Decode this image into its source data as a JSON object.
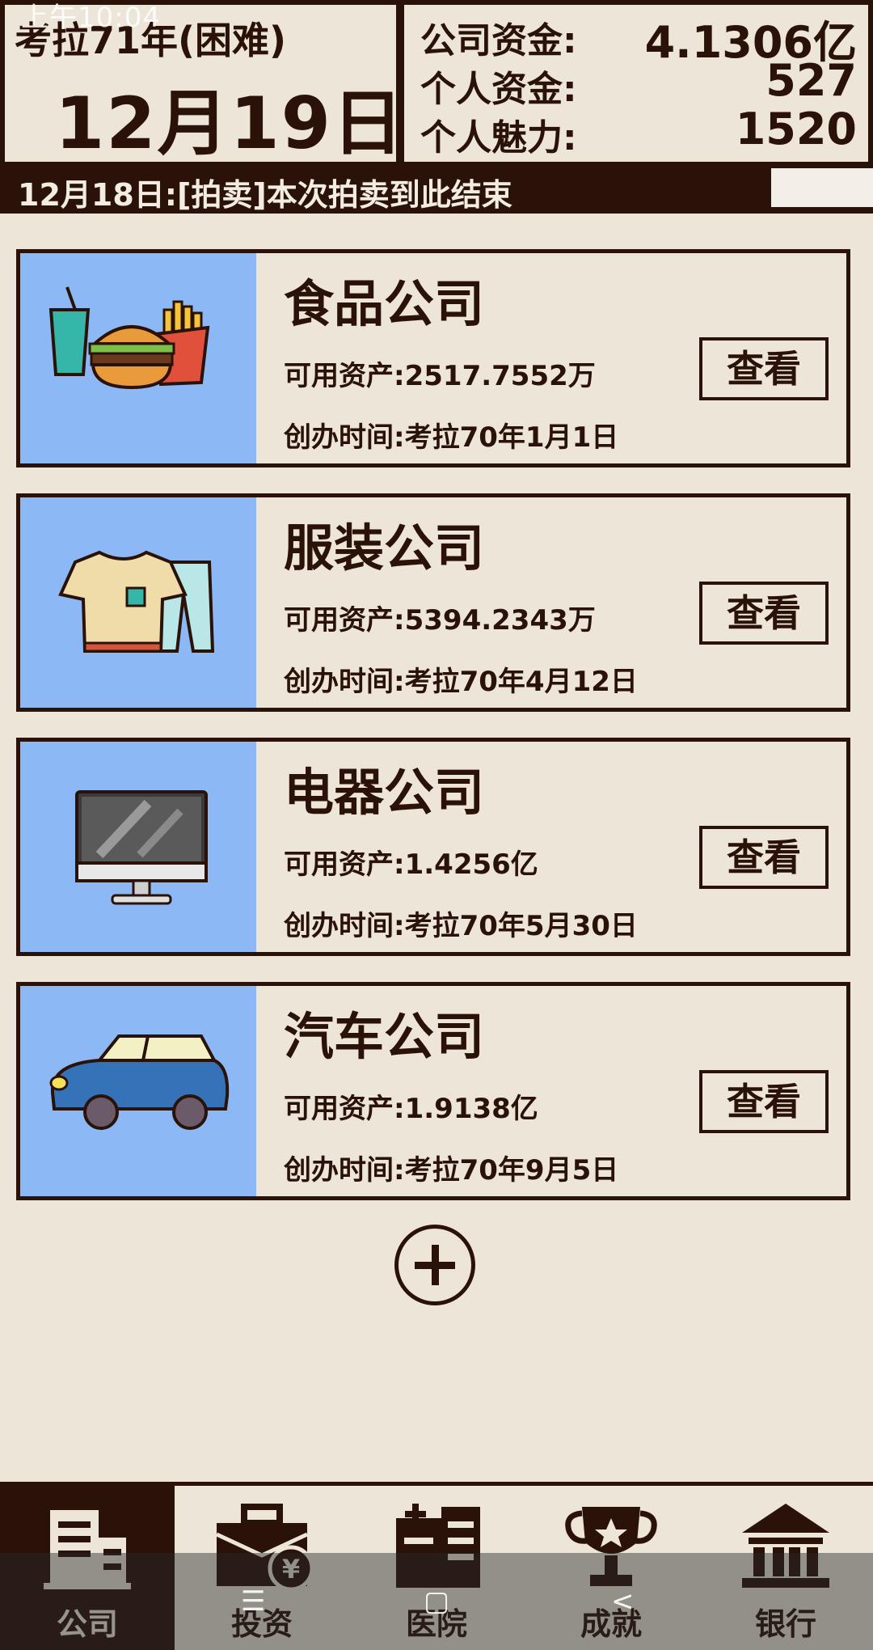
{
  "status": {
    "time": "上午10:04"
  },
  "header": {
    "era": "考拉71年(困难)",
    "date": "12月19日",
    "funds": [
      {
        "label": "公司资金:",
        "value": "4.1306亿"
      },
      {
        "label": "个人资金:",
        "value": "527"
      },
      {
        "label": "个人魅力:",
        "value": "1520"
      }
    ]
  },
  "news": {
    "text": "12月18日:[拍卖]本次拍卖到此结束"
  },
  "companies": [
    {
      "name": "食品公司",
      "assets": "可用资产:2517.7552万",
      "founded": "创办时间:考拉70年1月1日",
      "view_label": "查看",
      "icon": "food-icon"
    },
    {
      "name": "服装公司",
      "assets": "可用资产:5394.2343万",
      "founded": "创办时间:考拉70年4月12日",
      "view_label": "查看",
      "icon": "clothing-icon"
    },
    {
      "name": "电器公司",
      "assets": "可用资产:1.4256亿",
      "founded": "创办时间:考拉70年5月30日",
      "view_label": "查看",
      "icon": "monitor-icon"
    },
    {
      "name": "汽车公司",
      "assets": "可用资产:1.9138亿",
      "founded": "创办时间:考拉70年9月5日",
      "view_label": "查看",
      "icon": "car-icon"
    }
  ],
  "add_button": {
    "icon": "plus-circle-icon"
  },
  "nav": [
    {
      "label": "公司",
      "icon": "office-building-icon",
      "active": true
    },
    {
      "label": "投资",
      "icon": "briefcase-yen-icon",
      "active": false
    },
    {
      "label": "医院",
      "icon": "hospital-icon",
      "active": false
    },
    {
      "label": "成就",
      "icon": "trophy-icon",
      "active": false
    },
    {
      "label": "银行",
      "icon": "bank-icon",
      "active": false
    }
  ],
  "colors": {
    "dark": "#2a1208",
    "background": "#ece5d8",
    "card_image_bg": "#8cb9f5"
  }
}
